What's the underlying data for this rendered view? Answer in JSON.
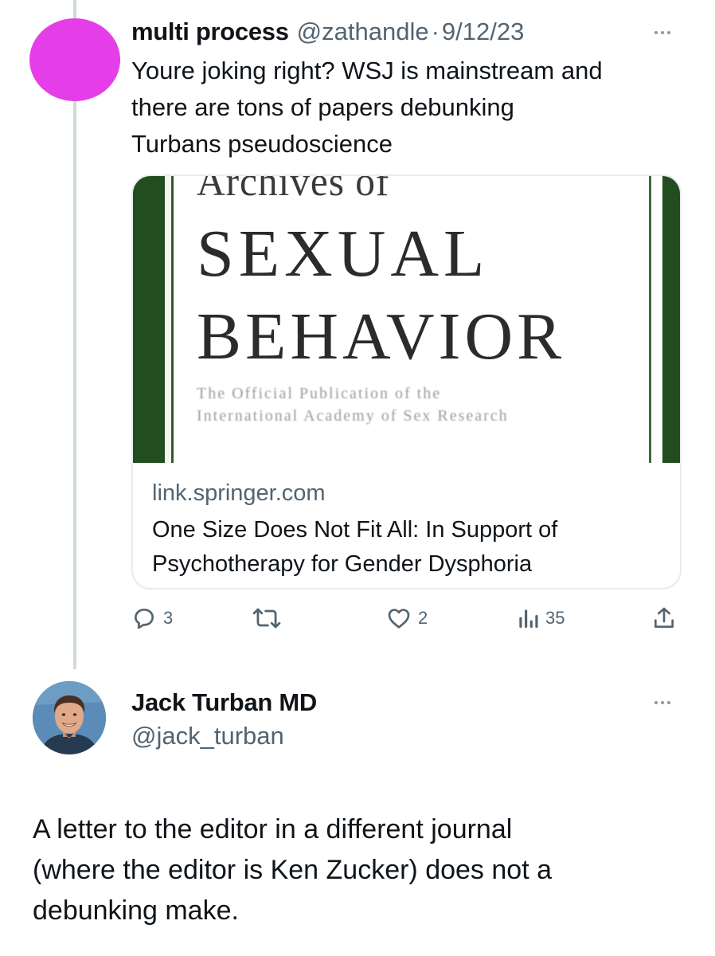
{
  "tweet1": {
    "author_name": "multi process",
    "handle": "@zathandle",
    "separator": "·",
    "date": "9/12/23",
    "avatar_color": "#e53ee8",
    "text": "Youre joking right? WSJ is mainstream and\nthere are tons of papers debunking\nTurbans pseudoscience",
    "card": {
      "image": {
        "journal_line1": "Archives of",
        "journal_line2": "SEXUAL",
        "journal_line3": "BEHAVIOR",
        "journal_sub1": "The Official Publication of the",
        "journal_sub2": "International Academy of Sex Research",
        "frame_color": "#224d1f"
      },
      "domain": "link.springer.com",
      "title": "One Size Does Not Fit All: In Support of\nPsychotherapy for Gender Dysphoria"
    },
    "actions": {
      "reply_icon": "reply-icon",
      "reply_count": "3",
      "retweet_icon": "retweet-icon",
      "like_icon": "heart-icon",
      "like_count": "2",
      "views_icon": "views-icon",
      "views_count": "35",
      "share_icon": "share-icon"
    },
    "more_icon": "more-icon"
  },
  "tweet2": {
    "author_name": "Jack Turban MD",
    "handle": "@jack_turban",
    "avatar": "avatar-photo",
    "text": "A letter to the editor in a different journal\n(where the editor is Ken Zucker) does not a\ndebunking make.",
    "more_icon": "more-icon"
  },
  "colors": {
    "text_primary": "#0f1419",
    "text_secondary": "#536471",
    "thread_line": "#cfd9de",
    "card_border": "#e6ecf0"
  }
}
